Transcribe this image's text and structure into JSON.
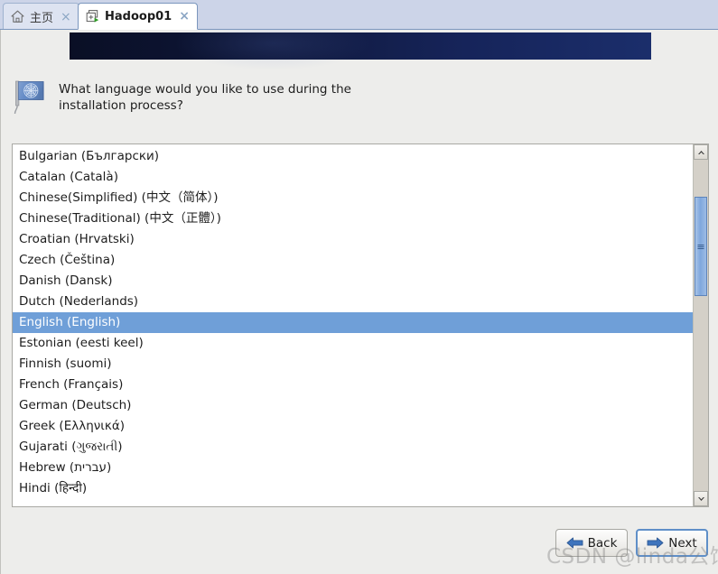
{
  "tabs": [
    {
      "label": "主页",
      "icon": "home-icon",
      "close": "×",
      "active": false
    },
    {
      "label": "Hadoop01",
      "icon": "vm-running-icon",
      "close": "×",
      "active": true
    }
  ],
  "banner": {
    "name": "installer-banner"
  },
  "question": {
    "icon": "un-flag-icon",
    "text": "What language would you like to use during the installation process?"
  },
  "language_list": {
    "selected": "English (English)",
    "items": [
      "Bulgarian (Български)",
      "Catalan (Català)",
      "Chinese(Simplified) (中文（简体）)",
      "Chinese(Traditional) (中文（正體）)",
      "Croatian (Hrvatski)",
      "Czech (Čeština)",
      "Danish (Dansk)",
      "Dutch (Nederlands)",
      "English (English)",
      "Estonian (eesti keel)",
      "Finnish (suomi)",
      "French (Français)",
      "German (Deutsch)",
      "Greek (Ελληνικά)",
      "Gujarati (ગુજરાતી)",
      "Hebrew (עברית)",
      "Hindi (हिन्दी)"
    ]
  },
  "scrollbar": {
    "up_arrow": "scroll-up-arrow-icon",
    "down_arrow": "scroll-down-arrow-icon",
    "thumb": "scrollbar-thumb"
  },
  "buttons": {
    "back": {
      "label": "Back",
      "icon": "arrow-left-icon"
    },
    "next": {
      "label": "Next",
      "icon": "arrow-right-icon"
    }
  },
  "watermark": {
    "text": "CSDN @linda公馆"
  },
  "colors": {
    "selection_blue": "#6f9fd8",
    "banner_dark": "#0a0f25",
    "banner_light": "#1b2e6b",
    "tabbar_bg": "#ccd4e8",
    "window_bg": "#ededeb",
    "focus_blue": "#5f8fc8"
  }
}
